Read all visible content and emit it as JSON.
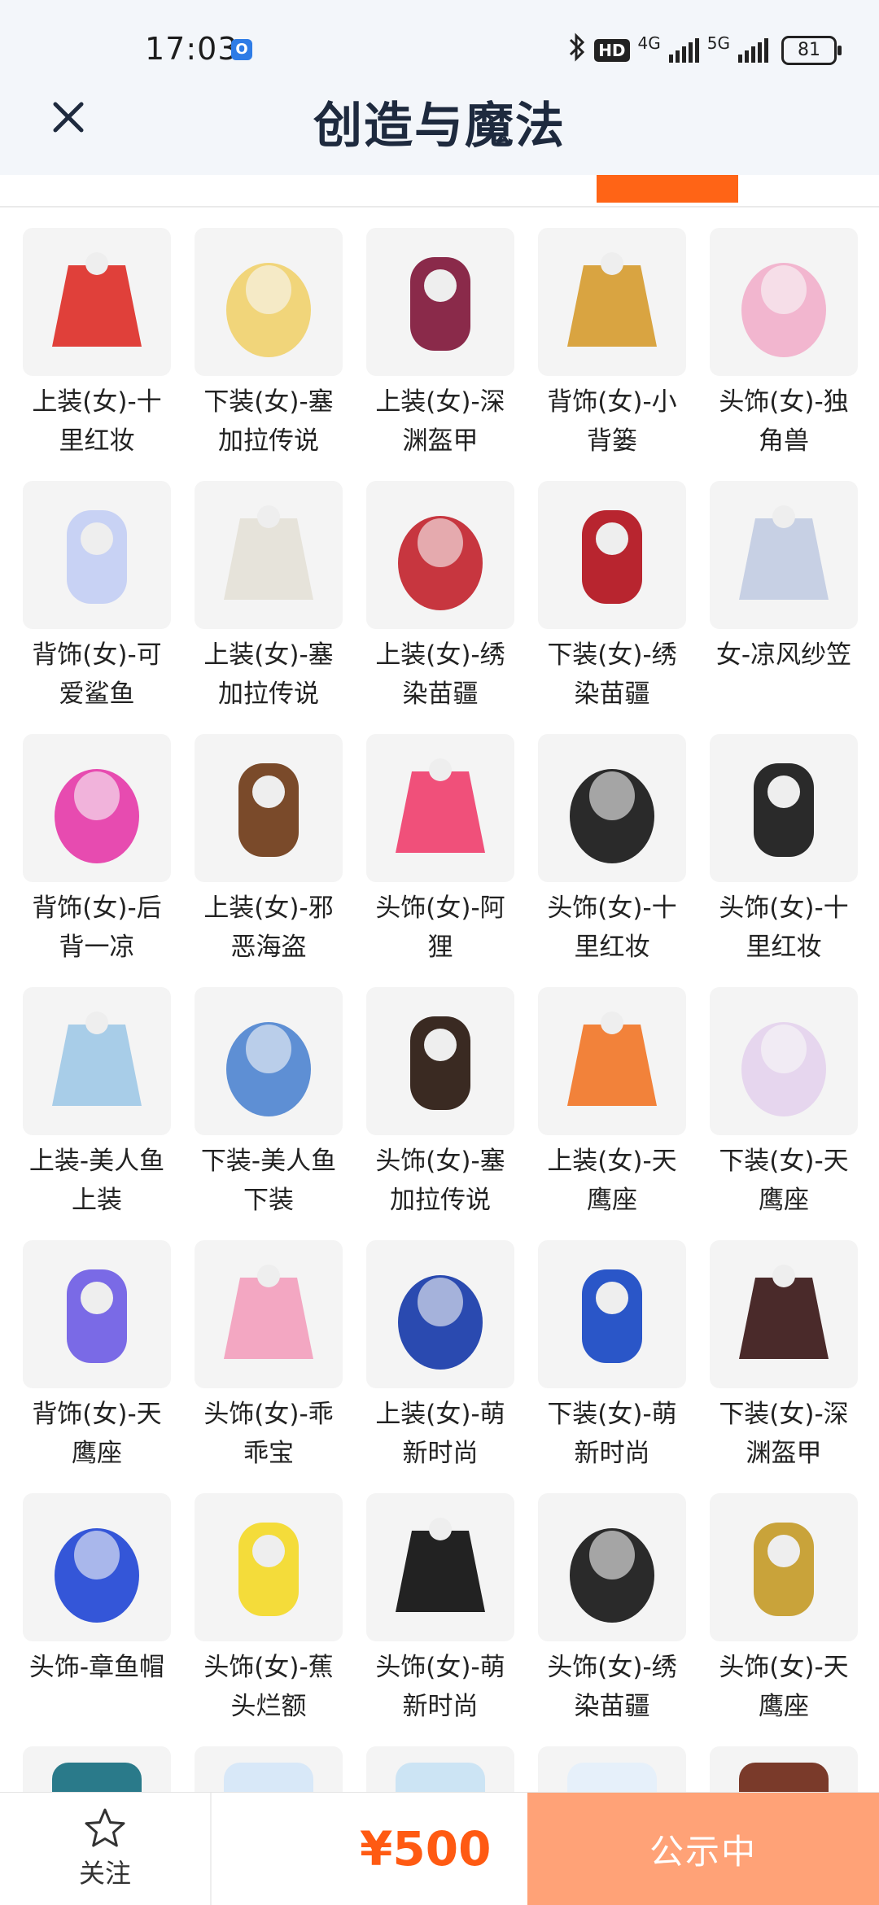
{
  "status_bar": {
    "time": "17:03",
    "clock_badge": "O",
    "hd_label": "HD",
    "net_4g": "4G",
    "net_5g": "5G",
    "battery": "81"
  },
  "header": {
    "title": "创造与魔法",
    "close_icon": "close-icon"
  },
  "tab_indicator_color": "#ff6416",
  "items": [
    {
      "label": "上装(女)-十里红妆",
      "color": "#e0403a"
    },
    {
      "label": "下装(女)-塞加拉传说",
      "color": "#f1d57a"
    },
    {
      "label": "上装(女)-深渊盔甲",
      "color": "#8a2a4a"
    },
    {
      "label": "背饰(女)-小背篓",
      "color": "#d9a441"
    },
    {
      "label": "头饰(女)-独角兽",
      "color": "#f2b6cf"
    },
    {
      "label": "背饰(女)-可爱鲨鱼",
      "color": "#c8d2f4"
    },
    {
      "label": "上装(女)-塞加拉传说",
      "color": "#e6e3da"
    },
    {
      "label": "上装(女)-绣染苗疆",
      "color": "#c7363f"
    },
    {
      "label": "下装(女)-绣染苗疆",
      "color": "#b8252f"
    },
    {
      "label": "女-凉风纱笠",
      "color": "#c7d0e4"
    },
    {
      "label": "背饰(女)-后背一凉",
      "color": "#e74bb0"
    },
    {
      "label": "上装(女)-邪恶海盗",
      "color": "#7a4a2a"
    },
    {
      "label": "头饰(女)-阿狸",
      "color": "#f0507a"
    },
    {
      "label": "头饰(女)-十里红妆",
      "color": "#2a2a2a"
    },
    {
      "label": "头饰(女)-十里红妆",
      "color": "#2a2a2a"
    },
    {
      "label": "上装-美人鱼上装",
      "color": "#a8cde8"
    },
    {
      "label": "下装-美人鱼下装",
      "color": "#5e8fd4"
    },
    {
      "label": "头饰(女)-塞加拉传说",
      "color": "#3a2a22"
    },
    {
      "label": "上装(女)-天鹰座",
      "color": "#f2823a"
    },
    {
      "label": "下装(女)-天鹰座",
      "color": "#e6d6ee"
    },
    {
      "label": "背饰(女)-天鹰座",
      "color": "#7a6ae6"
    },
    {
      "label": "头饰(女)-乖乖宝",
      "color": "#f3a7c2"
    },
    {
      "label": "上装(女)-萌新时尚",
      "color": "#2a4ab0"
    },
    {
      "label": "下装(女)-萌新时尚",
      "color": "#2a56c8"
    },
    {
      "label": "下装(女)-深渊盔甲",
      "color": "#4a2a2a"
    },
    {
      "label": "头饰-章鱼帽",
      "color": "#3456d8"
    },
    {
      "label": "头饰(女)-蕉头烂额",
      "color": "#f4dc3a"
    },
    {
      "label": "头饰(女)-萌新时尚",
      "color": "#222222"
    },
    {
      "label": "头饰(女)-绣染苗疆",
      "color": "#2a2a2a"
    },
    {
      "label": "头饰(女)-天鹰座",
      "color": "#c9a33a"
    }
  ],
  "partial_items_colors": [
    "#2a7a8a",
    "#d8e8f8",
    "#cce4f4",
    "#e6f0fa",
    "#7a3a2a"
  ],
  "bottom_bar": {
    "follow_label": "关注",
    "star_icon": "star-outline-icon",
    "price": "¥500",
    "status_button": "公示中",
    "price_color": "#ff5a12",
    "status_button_color": "#ffa277"
  }
}
